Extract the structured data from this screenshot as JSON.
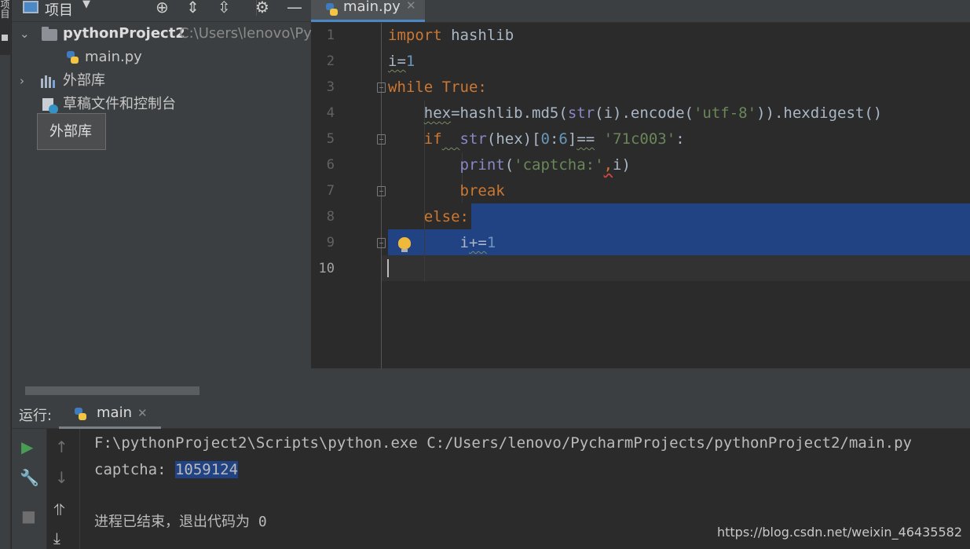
{
  "left_strip": {
    "tab_label": "项目"
  },
  "project_panel": {
    "title": "项目",
    "root_name": "pythonProject2",
    "root_path": "C:\\Users\\lenovo\\Pyc",
    "file_name": "main.py",
    "external_libs": "外部库",
    "scratches": "草稿文件和控制台",
    "tooltip": "外部库"
  },
  "editor": {
    "tab_label": "main.py",
    "line_numbers": [
      "1",
      "2",
      "3",
      "4",
      "5",
      "6",
      "7",
      "8",
      "9",
      "10"
    ],
    "lines": [
      "import hashlib",
      "i=1",
      "while True:",
      "    hex=hashlib.md5(str(i).encode('utf-8')).hexdigest()",
      "    if  str(hex)[0:6]== '71c003':",
      "        print('captcha:',i)",
      "        break",
      "    else:",
      "        i+=1",
      ""
    ],
    "tokens": {
      "l1": [
        "import",
        " hashlib"
      ],
      "l2": [
        "i=",
        "1"
      ],
      "l3": [
        "while",
        " ",
        "True",
        ":"
      ],
      "l4": [
        "    ",
        "hex",
        "=hashlib.md5(",
        "str",
        "(i).encode(",
        "'utf-8'",
        ")).hexdigest()"
      ],
      "l5": [
        "    ",
        "if",
        "  ",
        "str",
        "(hex)[",
        "0",
        ":",
        "6",
        "]",
        "==",
        " ",
        "'71c003'",
        ":"
      ],
      "l6": [
        "        ",
        "print",
        "(",
        "'captcha:'",
        ",",
        "i)"
      ],
      "l7": [
        "        ",
        "break"
      ],
      "l8": [
        "    ",
        "else",
        ":"
      ],
      "l9": [
        "        ",
        "i",
        "+=",
        "1"
      ]
    }
  },
  "run_panel": {
    "title": "运行:",
    "tab_label": "main",
    "console": {
      "command": "F:\\pythonProject2\\Scripts\\python.exe C:/Users/lenovo/PycharmProjects/pythonProject2/main.py",
      "output_prefix": "captcha: ",
      "output_value": "1059124",
      "exit_message": "进程已结束，退出代码为 0"
    }
  },
  "watermark": "https://blog.csdn.net/weixin_46435582",
  "colors": {
    "keyword": "#cc7832",
    "number": "#6897bb",
    "string": "#6a8759",
    "builtin": "#8888c6",
    "selection": "#214283",
    "run_green": "#499c54"
  }
}
